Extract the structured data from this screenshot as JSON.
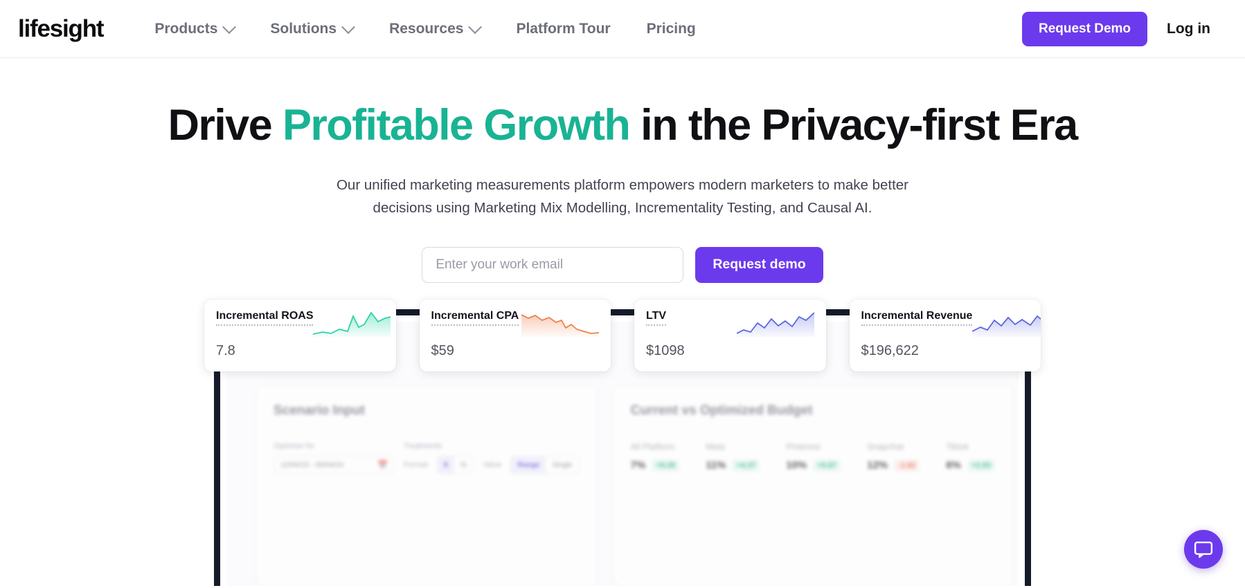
{
  "nav": {
    "logo": "lifesight",
    "items": [
      {
        "label": "Products",
        "has_chevron": true
      },
      {
        "label": "Solutions",
        "has_chevron": true
      },
      {
        "label": "Resources",
        "has_chevron": true
      },
      {
        "label": "Platform Tour",
        "has_chevron": false
      },
      {
        "label": "Pricing",
        "has_chevron": false
      }
    ],
    "demo_button": "Request Demo",
    "login": "Log in"
  },
  "hero": {
    "headline_part1": "Drive ",
    "headline_accent": "Profitable Growth",
    "headline_part2": " in the Privacy-first Era",
    "subtitle": "Our unified marketing measurements platform empowers modern marketers to make better decisions using Marketing Mix Modelling, Incrementality Testing, and Causal AI.",
    "email_placeholder": "Enter your work email",
    "email_value": "",
    "request_button": "Request demo"
  },
  "colors": {
    "accent_teal": "#19b394",
    "brand_purple": "#6c3aed",
    "text_dark": "#101014",
    "nav_grey": "#6c6e7a"
  },
  "dashboard": {
    "metric_cards": [
      {
        "title": "Incremental ROAS",
        "value": "7.8",
        "spark_color": "#2bd4a5"
      },
      {
        "title": "Incremental CPA",
        "value": "$59",
        "spark_color": "#f08a5d"
      },
      {
        "title": "LTV",
        "value": "$1098",
        "spark_color": "#6f7ae8"
      },
      {
        "title": "Incremental Revenue",
        "value": "$196,622",
        "spark_color": "#6f7ae8"
      }
    ],
    "scenario_panel": {
      "title": "Scenario Input",
      "optimize_for_label": "Optimize for",
      "treatments_label": "Treatments",
      "date_range": "12/04/23 - 05/04/24",
      "format_label": "Format",
      "currency_option": "$",
      "percent_option": "%",
      "value_label": "Value",
      "range_option": "Range",
      "single_option": "Single"
    },
    "budget_panel": {
      "title": "Current vs Optimized Budget",
      "platforms": [
        {
          "name": "All Platform",
          "pct": "7%",
          "delta": "+9.29",
          "direction": "up"
        },
        {
          "name": "Meta",
          "pct": "11%",
          "delta": "+4.37",
          "direction": "up"
        },
        {
          "name": "Pinterest",
          "pct": "10%",
          "delta": "+5.87",
          "direction": "up"
        },
        {
          "name": "Snapchat",
          "pct": "12%",
          "delta": "-1.62",
          "direction": "down"
        },
        {
          "name": "Tiktok",
          "pct": "6%",
          "delta": "+2.93",
          "direction": "up"
        }
      ]
    }
  },
  "chat": {
    "tooltip": "Open chat"
  }
}
